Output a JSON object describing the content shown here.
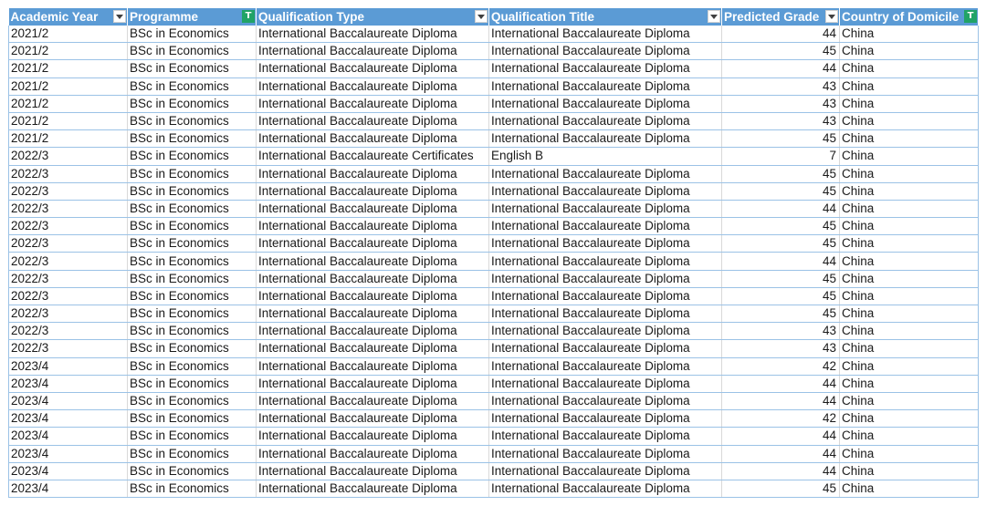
{
  "headers": [
    {
      "label": "Academic Year",
      "filter": "dropdown"
    },
    {
      "label": "Programme",
      "filter": "filtered"
    },
    {
      "label": "Qualification Type",
      "filter": "dropdown"
    },
    {
      "label": "Qualification Title",
      "filter": "dropdown"
    },
    {
      "label": "Predicted Grade",
      "filter": "dropdown"
    },
    {
      "label": "Country of Domicile",
      "filter": "filtered"
    }
  ],
  "rows": [
    [
      "2021/2",
      "BSc in Economics",
      "International Baccalaureate Diploma",
      "International Baccalaureate Diploma",
      "44",
      "China"
    ],
    [
      "2021/2",
      "BSc in Economics",
      "International Baccalaureate Diploma",
      "International Baccalaureate Diploma",
      "45",
      "China"
    ],
    [
      "2021/2",
      "BSc in Economics",
      "International Baccalaureate Diploma",
      "International Baccalaureate Diploma",
      "44",
      "China"
    ],
    [
      "2021/2",
      "BSc in Economics",
      "International Baccalaureate Diploma",
      "International Baccalaureate Diploma",
      "43",
      "China"
    ],
    [
      "2021/2",
      "BSc in Economics",
      "International Baccalaureate Diploma",
      "International Baccalaureate Diploma",
      "43",
      "China"
    ],
    [
      "2021/2",
      "BSc in Economics",
      "International Baccalaureate Diploma",
      "International Baccalaureate Diploma",
      "43",
      "China"
    ],
    [
      "2021/2",
      "BSc in Economics",
      "International Baccalaureate Diploma",
      "International Baccalaureate Diploma",
      "45",
      "China"
    ],
    [
      "2022/3",
      "BSc in Economics",
      "International Baccalaureate Certificates",
      "English B",
      "7",
      "China"
    ],
    [
      "2022/3",
      "BSc in Economics",
      "International Baccalaureate Diploma",
      "International Baccalaureate Diploma",
      "45",
      "China"
    ],
    [
      "2022/3",
      "BSc in Economics",
      "International Baccalaureate Diploma",
      "International Baccalaureate Diploma",
      "45",
      "China"
    ],
    [
      "2022/3",
      "BSc in Economics",
      "International Baccalaureate Diploma",
      "International Baccalaureate Diploma",
      "44",
      "China"
    ],
    [
      "2022/3",
      "BSc in Economics",
      "International Baccalaureate Diploma",
      "International Baccalaureate Diploma",
      "45",
      "China"
    ],
    [
      "2022/3",
      "BSc in Economics",
      "International Baccalaureate Diploma",
      "International Baccalaureate Diploma",
      "45",
      "China"
    ],
    [
      "2022/3",
      "BSc in Economics",
      "International Baccalaureate Diploma",
      "International Baccalaureate Diploma",
      "44",
      "China"
    ],
    [
      "2022/3",
      "BSc in Economics",
      "International Baccalaureate Diploma",
      "International Baccalaureate Diploma",
      "45",
      "China"
    ],
    [
      "2022/3",
      "BSc in Economics",
      "International Baccalaureate Diploma",
      "International Baccalaureate Diploma",
      "45",
      "China"
    ],
    [
      "2022/3",
      "BSc in Economics",
      "International Baccalaureate Diploma",
      "International Baccalaureate Diploma",
      "45",
      "China"
    ],
    [
      "2022/3",
      "BSc in Economics",
      "International Baccalaureate Diploma",
      "International Baccalaureate Diploma",
      "43",
      "China"
    ],
    [
      "2022/3",
      "BSc in Economics",
      "International Baccalaureate Diploma",
      "International Baccalaureate Diploma",
      "43",
      "China"
    ],
    [
      "2023/4",
      "BSc in Economics",
      "International Baccalaureate Diploma",
      "International Baccalaureate Diploma",
      "42",
      "China"
    ],
    [
      "2023/4",
      "BSc in Economics",
      "International Baccalaureate Diploma",
      "International Baccalaureate Diploma",
      "44",
      "China"
    ],
    [
      "2023/4",
      "BSc in Economics",
      "International Baccalaureate Diploma",
      "International Baccalaureate Diploma",
      "44",
      "China"
    ],
    [
      "2023/4",
      "BSc in Economics",
      "International Baccalaureate Diploma",
      "International Baccalaureate Diploma",
      "42",
      "China"
    ],
    [
      "2023/4",
      "BSc in Economics",
      "International Baccalaureate Diploma",
      "International Baccalaureate Diploma",
      "44",
      "China"
    ],
    [
      "2023/4",
      "BSc in Economics",
      "International Baccalaureate Diploma",
      "International Baccalaureate Diploma",
      "44",
      "China"
    ],
    [
      "2023/4",
      "BSc in Economics",
      "International Baccalaureate Diploma",
      "International Baccalaureate Diploma",
      "44",
      "China"
    ],
    [
      "2023/4",
      "BSc in Economics",
      "International Baccalaureate Diploma",
      "International Baccalaureate Diploma",
      "45",
      "China"
    ]
  ],
  "colors": {
    "header_bg": "#5b9bd5",
    "header_text": "#ffffff",
    "filter_active": "#21a366",
    "row_border": "#9bc2e6"
  }
}
